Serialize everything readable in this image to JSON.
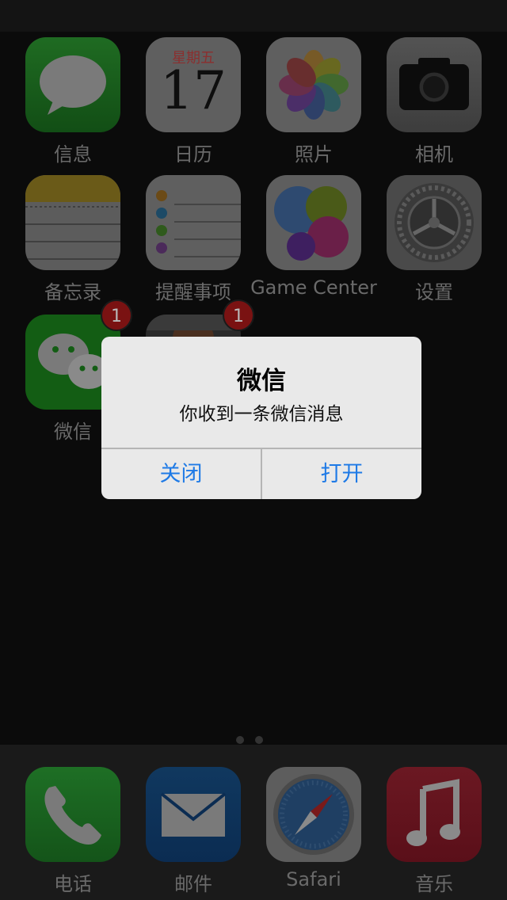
{
  "home": {
    "apps": [
      {
        "name": "信息",
        "icon": "messages-icon"
      },
      {
        "name": "日历",
        "icon": "calendar-icon",
        "weekday": "星期五",
        "day": "17"
      },
      {
        "name": "照片",
        "icon": "photos-icon"
      },
      {
        "name": "相机",
        "icon": "camera-icon"
      },
      {
        "name": "备忘录",
        "icon": "notes-icon"
      },
      {
        "name": "提醒事项",
        "icon": "reminders-icon"
      },
      {
        "name": "Game Center",
        "icon": "game-center-icon"
      },
      {
        "name": "设置",
        "icon": "settings-icon"
      },
      {
        "name": "微信",
        "icon": "wechat-icon",
        "badge": "1"
      },
      {
        "name": "",
        "icon": "game-app-icon",
        "badge": "1"
      }
    ]
  },
  "dock": {
    "apps": [
      {
        "name": "电话",
        "icon": "phone-icon"
      },
      {
        "name": "邮件",
        "icon": "mail-icon"
      },
      {
        "name": "Safari",
        "icon": "safari-icon"
      },
      {
        "name": "音乐",
        "icon": "music-icon"
      }
    ]
  },
  "alert": {
    "title": "微信",
    "message": "你收到一条微信消息",
    "buttons": {
      "close": "关闭",
      "open": "打开"
    },
    "button_color": "#1e7ae6"
  }
}
